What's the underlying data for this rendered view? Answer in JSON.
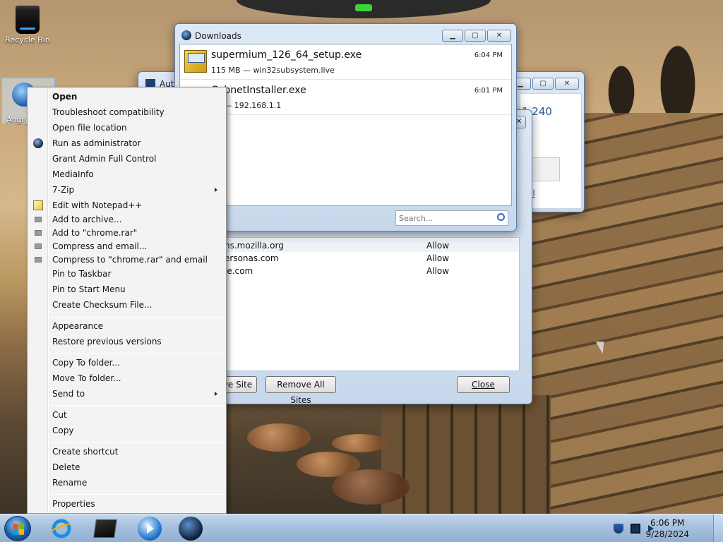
{
  "desktop": {
    "recycle_bin_label": "Recycle Bin",
    "angry_icon_label": "Angry"
  },
  "windows": {
    "back_window": {
      "title_partial": "Autz",
      "text_partial": "1.240",
      "link_partial": "el"
    },
    "permissions": {
      "rows": [
        {
          "site": "ns.mozilla.org",
          "status": "Allow"
        },
        {
          "site": "ersonas.com",
          "status": "Allow"
        },
        {
          "site": "le.com",
          "status": "Allow"
        }
      ],
      "remove_site_label": "ve Site",
      "remove_all_label": "Remove All Sites",
      "close_label": "Close"
    },
    "downloads": {
      "title": "Downloads",
      "items": [
        {
          "name": "supermium_126_64_setup.exe",
          "meta": "115 MB — win32subsystem.live",
          "time": "6:04 PM"
        },
        {
          "name": "CabnetInstaller.exe",
          "meta": "KB — 192.168.1.1",
          "time": "6:01 PM"
        }
      ],
      "search_placeholder": "Search..."
    }
  },
  "context_menu": {
    "items": [
      {
        "label": "Open",
        "bold": true
      },
      {
        "label": "Troubleshoot compatibility"
      },
      {
        "label": "Open file location"
      },
      {
        "label": "Run as administrator",
        "icon": "run-as-admin-icon"
      },
      {
        "label": "Grant Admin Full Control"
      },
      {
        "label": "MediaInfo"
      },
      {
        "label": "7-Zip",
        "submenu": true
      },
      {
        "label": "Edit with Notepad++",
        "icon": "notepad-icon"
      },
      {
        "label": "Add to archive...",
        "icon": "rar-icon"
      },
      {
        "label": "Add to \"chrome.rar\"",
        "icon": "rar-icon"
      },
      {
        "label": "Compress and email...",
        "icon": "rar-icon"
      },
      {
        "label": "Compress to \"chrome.rar\" and email",
        "icon": "rar-icon"
      },
      {
        "label": "Pin to Taskbar"
      },
      {
        "label": "Pin to Start Menu"
      },
      {
        "label": "Create Checksum File..."
      },
      {
        "label": "Appearance"
      },
      {
        "label": "Restore previous versions"
      },
      {
        "label": "Copy To folder..."
      },
      {
        "label": "Move To folder..."
      },
      {
        "label": "Send to",
        "submenu": true
      },
      {
        "label": "Cut"
      },
      {
        "label": "Copy"
      },
      {
        "label": "Create shortcut"
      },
      {
        "label": "Delete"
      },
      {
        "label": "Rename"
      },
      {
        "label": "Properties"
      }
    ]
  },
  "taskbar": {
    "apps": [
      "internet-explorer-icon",
      "command-prompt-icon",
      "media-player-icon",
      "browser-globe-icon"
    ],
    "tray": [
      "shield-icon",
      "monitor-icon",
      "speaker-icon"
    ],
    "clock": {
      "time": "6:06 PM",
      "date": "9/28/2024"
    }
  },
  "colors": {
    "window_frame": "#c7d8ec",
    "menu_bg": "#f3f3f3",
    "taskbar": "#a6c0de"
  }
}
